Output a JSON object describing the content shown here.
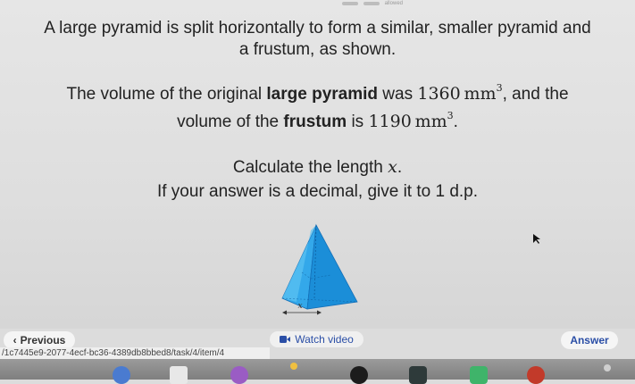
{
  "question": {
    "line1": "A large pyramid is split horizontally to form a similar, smaller pyramid and",
    "line2": "a frustum, as shown.",
    "line3_pre": "The volume of the original",
    "line3_bold": "large pyramid",
    "line3_mid": "was",
    "volume_large": "1360",
    "unit": "mm",
    "line3_post": ", and the",
    "line4_pre": "volume of the",
    "line4_bold": "frustum",
    "line4_mid": "is",
    "volume_frustum": "1190",
    "line4_post": ".",
    "cube": "3",
    "line5": "Calculate the length",
    "variable": "x",
    "line5_post": ".",
    "line6": "If your answer is a decimal, give it to 1 d.p."
  },
  "figure": {
    "label": "x",
    "colors": {
      "face_light": "#5cc3f2",
      "face_dark": "#1b8ed8",
      "face_mid": "#33a8ea",
      "outline": "#1570b8"
    }
  },
  "nav": {
    "previous_label": "Previous",
    "watch_label": "Watch video",
    "answer_label": "Answer"
  },
  "url": "/1c7445e9-2077-4ecf-bc36-4389db8bbed8/task/4/item/4",
  "topbar": {
    "tiny_text": "allowed"
  }
}
